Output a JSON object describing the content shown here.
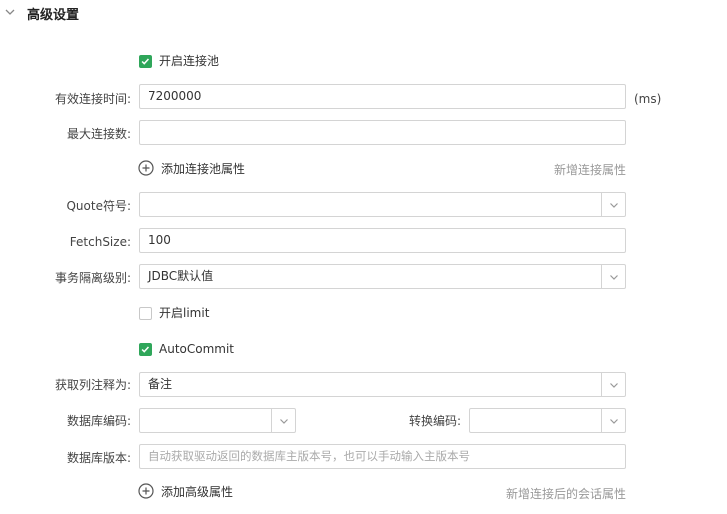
{
  "section": {
    "title": "高级设置",
    "expand_icon": "chevron-down-icon"
  },
  "pool": {
    "enable_label": "开启连接池",
    "enable_checked": true,
    "valid_time_label": "有效连接时间:",
    "valid_time_value": "7200000",
    "valid_time_unit": "(ms)",
    "max_conn_label": "最大连接数:",
    "max_conn_value": "",
    "add_property_label": "添加连接池属性",
    "new_property_hint": "新增连接属性"
  },
  "quote": {
    "label": "Quote符号:",
    "value": ""
  },
  "fetch_size": {
    "label": "FetchSize:",
    "value": "100"
  },
  "isolation": {
    "label": "事务隔离级别:",
    "value": "JDBC默认值"
  },
  "limit": {
    "label": "开启limit",
    "checked": false
  },
  "autocommit": {
    "label": "AutoCommit",
    "checked": true
  },
  "column_comment": {
    "label": "获取列注释为:",
    "value": "备注"
  },
  "encoding": {
    "db_label": "数据库编码:",
    "db_value": "",
    "convert_label": "转换编码:",
    "convert_value": ""
  },
  "db_version": {
    "label": "数据库版本:",
    "placeholder": "自动获取驱动返回的数据库主版本号，也可以手动输入主版本号"
  },
  "advanced": {
    "add_label": "添加高级属性",
    "session_hint": "新增连接后的会话属性"
  },
  "colors": {
    "accent_green": "#2fa65a",
    "border": "#d4d4d4",
    "muted_text": "#999999"
  }
}
